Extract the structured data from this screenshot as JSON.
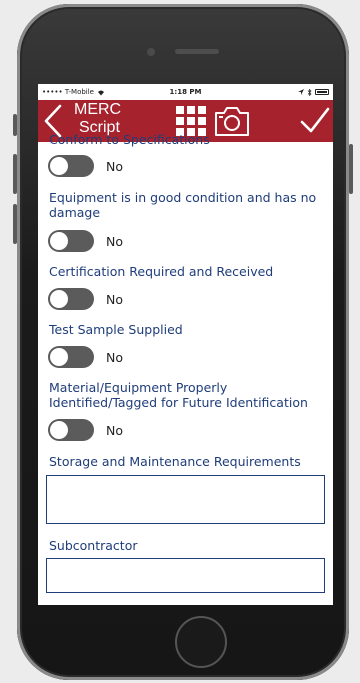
{
  "status": {
    "carrier": "••••• T-Mobile",
    "time": "1:18 PM"
  },
  "header": {
    "title_line1": "MERC",
    "title_line2": "Script",
    "bg_color": "#a6232e"
  },
  "fields": [
    {
      "label": "Conform to Specifications",
      "value": "No"
    },
    {
      "label": "Equipment is in good condition and has no damage",
      "value": "No"
    },
    {
      "label": "Certification Required and Received",
      "value": "No"
    },
    {
      "label": "Test Sample Supplied",
      "value": "No"
    },
    {
      "label": "Material/Equipment Properly Identified/Tagged for Future Identification",
      "value": "No"
    }
  ],
  "text_fields": [
    {
      "label": "Storage and Maintenance Requirements",
      "value": ""
    },
    {
      "label": "Subcontractor",
      "value": ""
    }
  ],
  "icons": {
    "back": "chevron-left-icon",
    "grid": "grid-icon",
    "camera": "camera-icon",
    "check": "checkmark-icon"
  }
}
